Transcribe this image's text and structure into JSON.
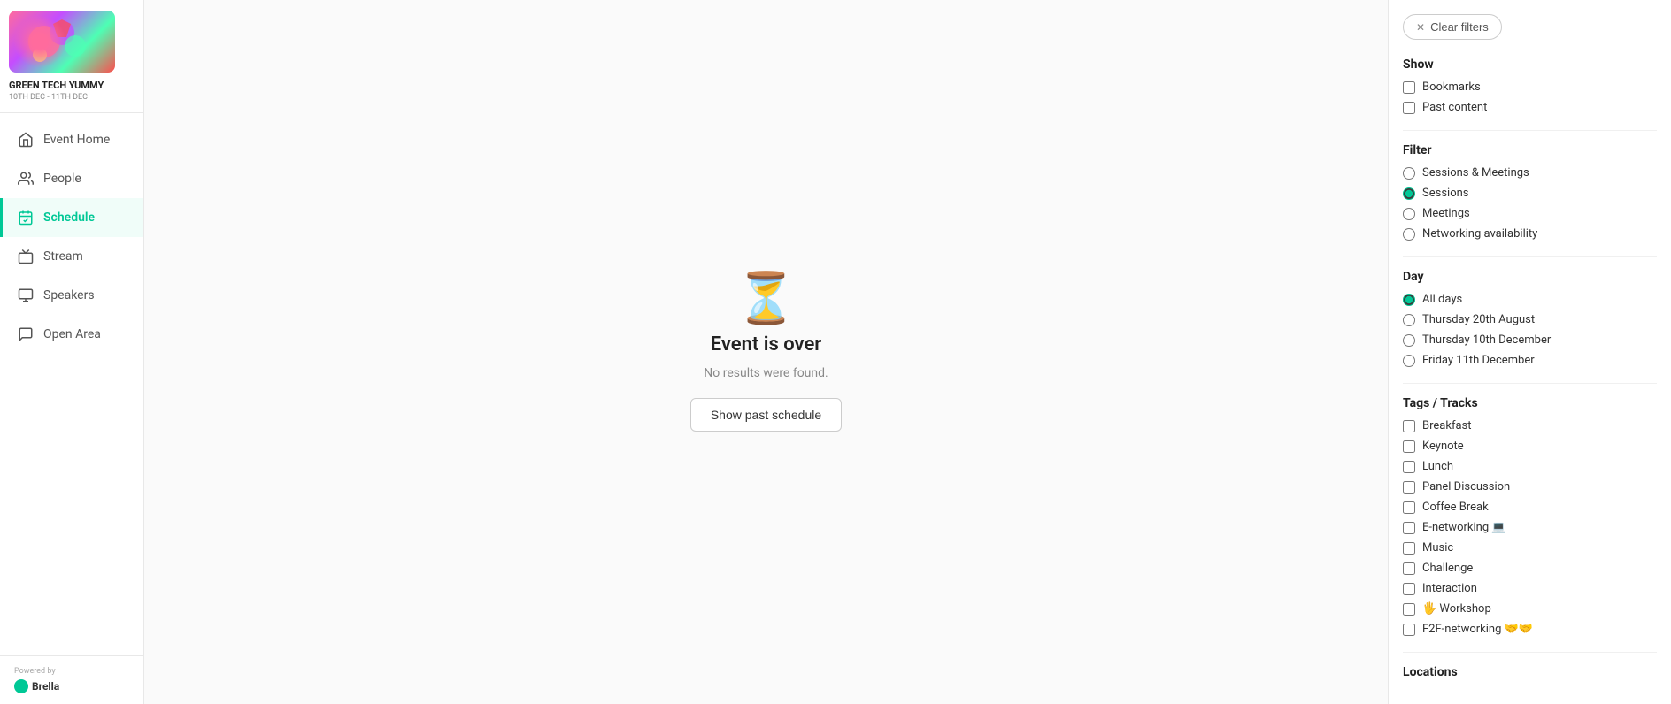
{
  "event": {
    "name": "GREEN TECH YUMMY",
    "dates": "10TH DEC - 11TH DEC"
  },
  "sidebar": {
    "nav_items": [
      {
        "id": "event-home",
        "label": "Event Home",
        "icon": "🏠",
        "active": false
      },
      {
        "id": "people",
        "label": "People",
        "icon": "👥",
        "active": false
      },
      {
        "id": "schedule",
        "label": "Schedule",
        "icon": "✅",
        "active": true
      },
      {
        "id": "stream",
        "label": "Stream",
        "icon": "📺",
        "active": false
      },
      {
        "id": "speakers",
        "label": "Speakers",
        "icon": "🖨",
        "active": false
      },
      {
        "id": "open-area",
        "label": "Open Area",
        "icon": "💬",
        "active": false
      }
    ],
    "powered_by": "Powered by",
    "brella_label": "Brella"
  },
  "main": {
    "icon": "⏳",
    "title": "Event is over",
    "subtitle": "No results were found.",
    "show_past_label": "Show past schedule"
  },
  "filter_panel": {
    "clear_filters_label": "Clear filters",
    "show_section": {
      "title": "Show",
      "options": [
        {
          "id": "bookmarks",
          "label": "Bookmarks",
          "checked": false
        },
        {
          "id": "past-content",
          "label": "Past content",
          "checked": false
        }
      ]
    },
    "filter_section": {
      "title": "Filter",
      "options": [
        {
          "id": "sessions-meetings",
          "label": "Sessions & Meetings",
          "selected": false
        },
        {
          "id": "sessions",
          "label": "Sessions",
          "selected": true
        },
        {
          "id": "meetings",
          "label": "Meetings",
          "selected": false
        },
        {
          "id": "networking",
          "label": "Networking availability",
          "selected": false
        }
      ]
    },
    "day_section": {
      "title": "Day",
      "options": [
        {
          "id": "all-days",
          "label": "All days",
          "selected": true
        },
        {
          "id": "thu-20-aug",
          "label": "Thursday 20th August",
          "selected": false
        },
        {
          "id": "thu-10-dec",
          "label": "Thursday 10th December",
          "selected": false
        },
        {
          "id": "fri-11-dec",
          "label": "Friday 11th December",
          "selected": false
        }
      ]
    },
    "tags_section": {
      "title": "Tags / Tracks",
      "options": [
        {
          "id": "breakfast",
          "label": "Breakfast",
          "checked": false,
          "emoji": ""
        },
        {
          "id": "keynote",
          "label": "Keynote",
          "checked": false,
          "emoji": ""
        },
        {
          "id": "lunch",
          "label": "Lunch",
          "checked": false,
          "emoji": ""
        },
        {
          "id": "panel-discussion",
          "label": "Panel Discussion",
          "checked": false,
          "emoji": ""
        },
        {
          "id": "coffee-break",
          "label": "Coffee Break",
          "checked": false,
          "emoji": ""
        },
        {
          "id": "e-networking",
          "label": "E-networking 💻",
          "checked": false,
          "emoji": ""
        },
        {
          "id": "music",
          "label": "Music",
          "checked": false,
          "emoji": ""
        },
        {
          "id": "challenge",
          "label": "Challenge",
          "checked": false,
          "emoji": ""
        },
        {
          "id": "interaction",
          "label": "Interaction",
          "checked": false,
          "emoji": ""
        },
        {
          "id": "workshop",
          "label": "🖐 Workshop",
          "checked": false,
          "emoji": ""
        },
        {
          "id": "f2f-networking",
          "label": "F2F-networking 🤝🤝",
          "checked": false,
          "emoji": ""
        }
      ]
    },
    "locations_title": "Locations"
  }
}
